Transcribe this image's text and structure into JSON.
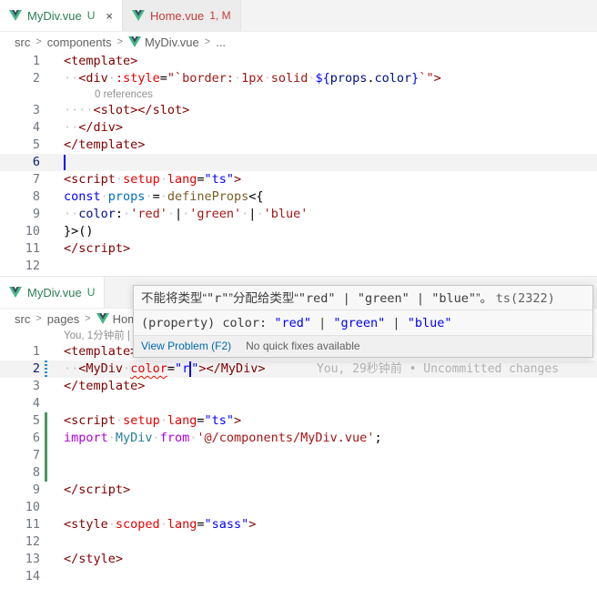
{
  "top": {
    "tabs": [
      {
        "name": "MyDiv.vue",
        "badge": "U",
        "close": "×"
      },
      {
        "name": "Home.vue",
        "badge": "1, M"
      }
    ],
    "breadcrumb": [
      "src",
      "components",
      "MyDiv.vue",
      "..."
    ],
    "codelens": "0 references",
    "line_numbers": [
      "1",
      "2",
      "3",
      "4",
      "5",
      "6",
      "7",
      "8",
      "9",
      "10",
      "11",
      "12"
    ]
  },
  "bottom": {
    "tabs": [
      {
        "name": "MyDiv.vue",
        "badge": "U"
      }
    ],
    "breadcrumb": [
      "src",
      "pages",
      "Hom"
    ],
    "blame_lens": "You, 1分钟前 |",
    "blame_inline": "You, 29秒钟前 • Uncommitted changes",
    "line_numbers": [
      "1",
      "2",
      "3",
      "4",
      "5",
      "6",
      "7",
      "8",
      "9",
      "10",
      "11",
      "12",
      "13",
      "14"
    ]
  },
  "hover": {
    "msg_prefix": "不能将类型“",
    "msg_given": "\"r\"",
    "msg_middle": "”分配给类型“",
    "msg_target": "\"red\" | \"green\" | \"blue\"",
    "msg_suffix": "”。",
    "msg_code": "ts(2322)",
    "sig_property": "(property) color:",
    "sig_types": [
      "\"red\"",
      "\"green\"",
      "\"blue\""
    ],
    "sig_pipe": "|",
    "view_problem": "View Problem (F2)",
    "no_fixes": "No quick fixes available"
  },
  "colors": {
    "vue_green": "#41b883",
    "vue_dark": "#35495e",
    "error": "#e51400",
    "added": "#48985d",
    "modified": "#2090d3"
  }
}
